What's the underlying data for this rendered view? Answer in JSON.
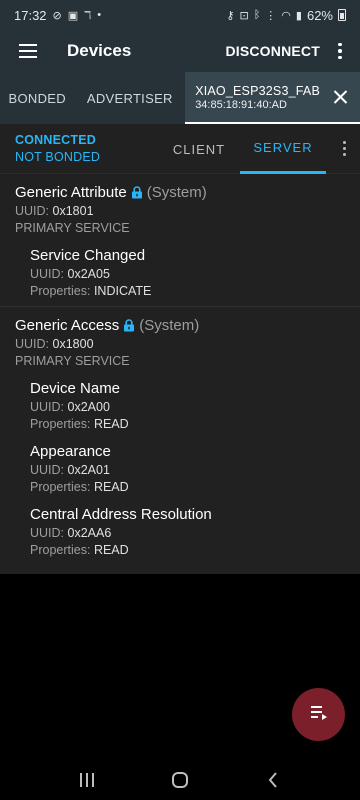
{
  "status_bar": {
    "time": "17:32",
    "battery": "62%"
  },
  "app_bar": {
    "title": "Devices",
    "disconnect_label": "DISCONNECT"
  },
  "tabs": {
    "bonded": "BONDED",
    "advertiser": "ADVERTISER",
    "device_name": "XIAO_ESP32S3_FAB",
    "device_mac": "34:85:18:91:40:AD"
  },
  "connection": {
    "status": "CONNECTED",
    "bond_status": "NOT BONDED",
    "client_tab": "CLIENT",
    "server_tab": "SERVER"
  },
  "services": [
    {
      "name": "Generic Attribute",
      "tag": "(System)",
      "uuid_label": "UUID:",
      "uuid": "0x1801",
      "type": "PRIMARY SERVICE",
      "characteristics": [
        {
          "name": "Service Changed",
          "uuid_label": "UUID:",
          "uuid": "0x2A05",
          "props_label": "Properties:",
          "props": "INDICATE"
        }
      ]
    },
    {
      "name": "Generic Access",
      "tag": "(System)",
      "uuid_label": "UUID:",
      "uuid": "0x1800",
      "type": "PRIMARY SERVICE",
      "characteristics": [
        {
          "name": "Device Name",
          "uuid_label": "UUID:",
          "uuid": "0x2A00",
          "props_label": "Properties:",
          "props": "READ"
        },
        {
          "name": "Appearance",
          "uuid_label": "UUID:",
          "uuid": "0x2A01",
          "props_label": "Properties:",
          "props": "READ"
        },
        {
          "name": "Central Address Resolution",
          "uuid_label": "UUID:",
          "uuid": "0x2AA6",
          "props_label": "Properties:",
          "props": "READ"
        }
      ]
    }
  ],
  "colors": {
    "app_bar": "#263238",
    "accent": "#29b6f6",
    "fab": "#7b1f2a",
    "panel": "#212121"
  }
}
